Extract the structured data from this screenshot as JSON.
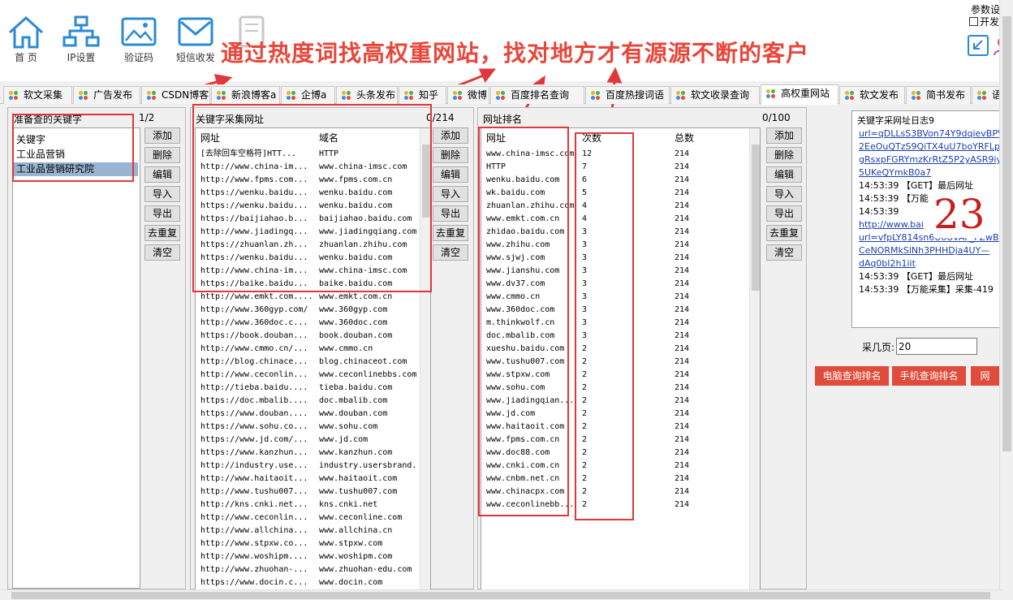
{
  "toolbar": {
    "items": [
      {
        "label": "首 页",
        "icon": "home-icon"
      },
      {
        "label": "IP设置",
        "icon": "network-icon"
      },
      {
        "label": "验证码",
        "icon": "image-icon"
      },
      {
        "label": "短信收发",
        "icon": "mail-icon"
      },
      {
        "label": "",
        "icon": "document-icon"
      }
    ],
    "headline": "通过热度词找高权重网站，找对地方才有源源不断的客户",
    "params_label": "参数设",
    "params_checkbox": "开发"
  },
  "tabs": [
    "软文采集",
    "广告发布",
    "CSDN博客",
    "新浪博客a",
    "企博a",
    "头条发布",
    "知乎",
    "微博",
    "百度排名查询",
    "百度热搜词语",
    "软文收录查询",
    "高权重网站",
    "软文发布",
    "简书发布",
    "语音转"
  ],
  "active_tab": "高权重网站",
  "keywords_panel": {
    "title": "准备查的关键字",
    "count": "1/2",
    "items": [
      "关键字",
      "工业品营销",
      "工业品营销研究院"
    ],
    "buttons": [
      "添加",
      "删除",
      "编辑",
      "导入",
      "导出",
      "去重复",
      "清空"
    ]
  },
  "urls_panel": {
    "title": "关键字采集网址",
    "count": "0/214",
    "col_url": "网址",
    "col_domain": "域名",
    "rows": [
      [
        "[去除回车空格符]HTT...",
        "HTTP"
      ],
      [
        "http://www.china-im...",
        "www.china-imsc.com"
      ],
      [
        "http://www.fpms.com...",
        "www.fpms.com.cn"
      ],
      [
        "https://wenku.baidu...",
        "wenku.baidu.com"
      ],
      [
        "https://wenku.baidu...",
        "wenku.baidu.com"
      ],
      [
        "https://baijiahao.b...",
        "baijiahao.baidu.com"
      ],
      [
        "http://www.jiadingq...",
        "www.jiadingqiang.com"
      ],
      [
        "https://zhuanlan.zh...",
        "zhuanlan.zhihu.com"
      ],
      [
        "https://wenku.baidu...",
        "wenku.baidu.com"
      ],
      [
        "http://www.china-im...",
        "www.china-imsc.com"
      ],
      [
        "https://baike.baidu...",
        "baike.baidu.com"
      ],
      [
        "http://www.emkt.com....",
        "www.emkt.com.cn"
      ],
      [
        "http://www.360gyp.com/",
        "www.360gyp.com"
      ],
      [
        "http://www.360doc.c...",
        "www.360doc.com"
      ],
      [
        "https://book.douban...",
        "book.douban.com"
      ],
      [
        "http://www.cmmo.cn/...",
        "www.cmmo.cn"
      ],
      [
        "http://blog.chinace...",
        "blog.chinaceot.com"
      ],
      [
        "http://www.ceconlin...",
        "www.ceconlinebbs.com"
      ],
      [
        "http://tieba.baidu....",
        "tieba.baidu.com"
      ],
      [
        "https://doc.mbalib....",
        "doc.mbalib.com"
      ],
      [
        "https://www.douban....",
        "www.douban.com"
      ],
      [
        "https://www.sohu.co...",
        "www.sohu.com"
      ],
      [
        "https://www.jd.com/...",
        "www.jd.com"
      ],
      [
        "https://www.kanzhun...",
        "www.kanzhun.com"
      ],
      [
        "http://industry.use...",
        "industry.usersbrand."
      ],
      [
        "http://www.haitaoit...",
        "www.haitaoit.com"
      ],
      [
        "http://www.tushu007...",
        "www.tushu007.com"
      ],
      [
        "http://kns.cnki.net...",
        "kns.cnki.net"
      ],
      [
        "http://www.ceconlin...",
        "www.ceconline.com"
      ],
      [
        "http://www.allchina...",
        "www.allchina.cn"
      ],
      [
        "http://www.stpxw.co...",
        "www.stpxw.com"
      ],
      [
        "http://www.woshipm....",
        "www.woshipm.com"
      ],
      [
        "http://www.zhuohan-...",
        "www.zhuohan-edu.com"
      ],
      [
        "https://www.docin.c...",
        "www.docin.com"
      ]
    ],
    "buttons": [
      "添加",
      "删除",
      "编辑",
      "导入",
      "导出",
      "去重复",
      "清空"
    ]
  },
  "ranking_panel": {
    "title": "网址排名",
    "count": "0/100",
    "col_url": "网址",
    "col_times": "次数",
    "col_total": "总数",
    "rows": [
      [
        "www.china-imsc.com",
        "12",
        "214"
      ],
      [
        "HTTP",
        "7",
        "214"
      ],
      [
        "wenku.baidu.com",
        "6",
        "214"
      ],
      [
        "wk.baidu.com",
        "5",
        "214"
      ],
      [
        "zhuanlan.zhihu.com",
        "4",
        "214"
      ],
      [
        "www.emkt.com.cn",
        "4",
        "214"
      ],
      [
        "zhidao.baidu.com",
        "3",
        "214"
      ],
      [
        "www.zhihu.com",
        "3",
        "214"
      ],
      [
        "www.sjwj.com",
        "3",
        "214"
      ],
      [
        "www.jianshu.com",
        "3",
        "214"
      ],
      [
        "www.dv37.com",
        "3",
        "214"
      ],
      [
        "www.cmmo.cn",
        "3",
        "214"
      ],
      [
        "www.360doc.com",
        "3",
        "214"
      ],
      [
        "m.thinkwolf.cn",
        "3",
        "214"
      ],
      [
        "doc.mbalib.com",
        "3",
        "214"
      ],
      [
        "xueshu.baidu.com",
        "2",
        "214"
      ],
      [
        "www.tushu007.com",
        "2",
        "214"
      ],
      [
        "www.stpxw.com",
        "2",
        "214"
      ],
      [
        "www.sohu.com",
        "2",
        "214"
      ],
      [
        "www.jiadingqian...",
        "2",
        "214"
      ],
      [
        "www.jd.com",
        "2",
        "214"
      ],
      [
        "www.haitaoit.com",
        "2",
        "214"
      ],
      [
        "www.fpms.com.cn",
        "2",
        "214"
      ],
      [
        "www.doc88.com",
        "2",
        "214"
      ],
      [
        "www.cnki.com.cn",
        "2",
        "214"
      ],
      [
        "www.cnbm.net.cn",
        "2",
        "214"
      ],
      [
        "www.chinacpx.com",
        "2",
        "214"
      ],
      [
        "www.ceconlinebb...",
        "2",
        "214"
      ]
    ],
    "buttons": [
      "添加",
      "删除",
      "编辑",
      "导入",
      "导出",
      "去重复",
      "清空"
    ]
  },
  "log_panel": {
    "title": "关键字采网址日志9",
    "lines": [
      {
        "text": "url=qDLLsS3BVon74Y9dqievBPVEc",
        "link": true
      },
      {
        "text": "2EeOuQTzS9QiTX4uU7boYRFLpEY5k",
        "link": true
      },
      {
        "text": "gRsxpFGRYmzKrRtZ5P2yASR9iyuar",
        "link": true
      },
      {
        "text": "5UKeQYmkB0a7",
        "link": true
      },
      {
        "text": "14:53:39 【GET】最后网址",
        "link": false
      },
      {
        "text": "14:53:39 【万能",
        "link": false
      },
      {
        "text": "14:53:39",
        "link": false
      },
      {
        "text": "http://www.bai",
        "link": true
      },
      {
        "text": "url=vfpLY814sn6U6UvAF_FZwBt6v",
        "link": true
      },
      {
        "text": "CeNORMkSlNh3PHHDja4UY—",
        "link": true
      },
      {
        "text": "dAq0bI2h1iit",
        "link": true
      },
      {
        "text": "14:53:39 【GET】最后网址",
        "link": false
      },
      {
        "text": "14:53:39 【万能采集】采集-419",
        "link": false
      }
    ],
    "overlay_number": "23",
    "overlay_suffix": ".9"
  },
  "pages": {
    "label": "采几页:",
    "value": "20"
  },
  "action_buttons": [
    "电脑查询排名",
    "手机查询排名",
    "网"
  ],
  "colors": {
    "accent_red": "#e04c3c",
    "annotation_red": "#e0383a",
    "selected": "#99b4d1"
  }
}
